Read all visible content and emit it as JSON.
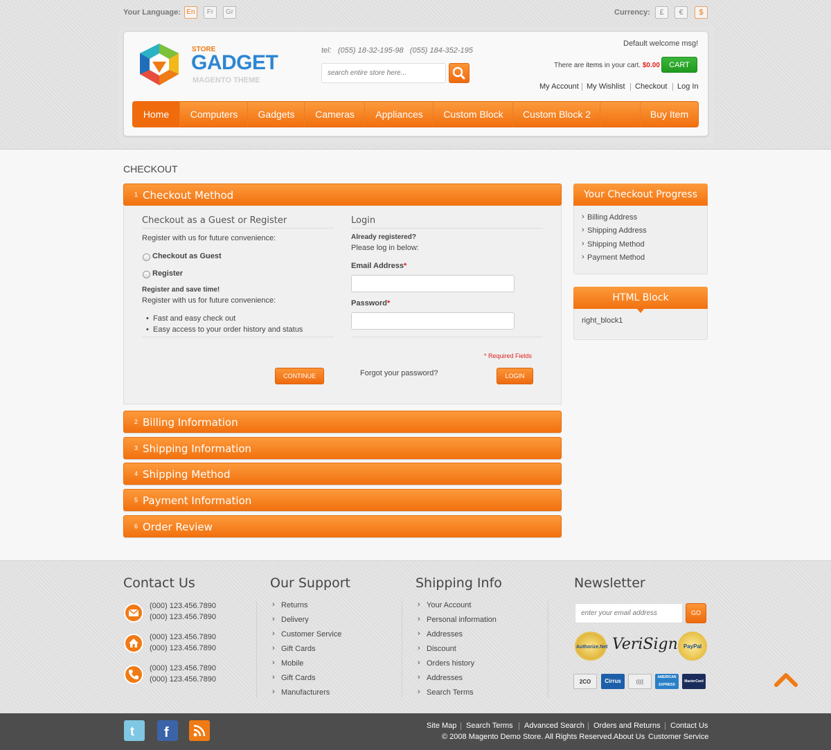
{
  "topbar": {
    "language_label": "Your Language:",
    "languages": [
      "En",
      "Fr",
      "Gr"
    ],
    "currency_label": "Currency:",
    "currencies": [
      "£",
      "€",
      "$"
    ]
  },
  "logo": {
    "store": "STORE",
    "name": "GADGET",
    "subtitle": "MAGENTO THEME"
  },
  "header": {
    "tel": "tel:   (055) 18-32-195-98   (055) 184-352-195",
    "search_placeholder": "search entire store here...",
    "welcome": "Default welcome msg!",
    "cart_text_prefix": "There are ",
    "cart_items": "items",
    "cart_text_suffix": " in your cart.",
    "cart_amount": "$0.00",
    "cart_button": "CART",
    "links": [
      "My Account",
      "My Wishlist",
      "Checkout",
      "Log In"
    ]
  },
  "nav": {
    "items": [
      "Home",
      "Computers",
      "Gadgets",
      "Cameras",
      "Appliances",
      "Custom Block",
      "Custom Block 2"
    ],
    "buy_item": "Buy Item"
  },
  "page": {
    "title": "CHECKOUT"
  },
  "checkout": {
    "steps": [
      {
        "num": "1",
        "title": "Checkout Method"
      },
      {
        "num": "2",
        "title": "Billing Information"
      },
      {
        "num": "3",
        "title": "Shipping Information"
      },
      {
        "num": "4",
        "title": "Shipping Method"
      },
      {
        "num": "5",
        "title": "Payment Information"
      },
      {
        "num": "6",
        "title": "Order Review"
      }
    ],
    "guest": {
      "heading": "Checkout as a Guest or Register",
      "intro": "Register with us for future convenience:",
      "option_guest": "Checkout as Guest",
      "option_register": "Register",
      "save_time": "Register and save time!",
      "intro2": "Register with us for future convenience:",
      "bullets": [
        "Fast and easy check out",
        "Easy access to your order history and status"
      ],
      "continue": "CONTINUE"
    },
    "login": {
      "heading": "Login",
      "already": "Already registered?",
      "please": "Please log in below:",
      "email_label": "Email Address",
      "password_label": "Password",
      "required_mark": "*",
      "required_note": "* Required Fields",
      "forgot": "Forgot your password?",
      "login_btn": "LOGIN"
    }
  },
  "sidebar": {
    "progress_title": "Your Checkout Progress",
    "progress_items": [
      "Billing Address",
      "Shipping Address",
      "Shipping Method",
      "Payment Method"
    ],
    "html_block_title": "HTML Block",
    "html_block_text": "right_block1"
  },
  "footer": {
    "contact": {
      "title": "Contact Us",
      "phones": [
        "(000) 123.456.7890",
        "(000) 123.456.7890",
        "(000) 123.456.7890",
        "(000) 123.456.7890",
        "(000) 123.456.7890",
        "(000) 123.456.7890"
      ]
    },
    "support": {
      "title": "Our Support",
      "links": [
        "Returns",
        "Delivery",
        "Customer Service",
        "Gift Cards",
        "Mobile",
        "Gift Cards",
        "Manufacturers"
      ]
    },
    "shipping": {
      "title": "Shipping Info",
      "links": [
        "Your Account",
        "Personal information",
        "Addresses",
        "Discount",
        "Orders history",
        "Addresses",
        "Search Terms"
      ]
    },
    "newsletter": {
      "title": "Newsletter",
      "placeholder": "enter your email address",
      "go": "GO",
      "badges": [
        "Authorize.Net",
        "VeriSign",
        "PayPal"
      ],
      "cards": [
        "2CO",
        "Cirrus",
        "((((",
        "AMERICAN EXPRESS",
        "MasterCard"
      ]
    }
  },
  "bottom": {
    "links": [
      "Site Map",
      "Search Terms",
      "Advanced Search",
      "Orders and Returns",
      "Contact Us"
    ],
    "copyright": "© 2008 Magento Demo Store. All Rights Reserved.",
    "about": "About Us",
    "customer_service": "Customer Service"
  },
  "colors": {
    "accent": "#f07a14",
    "cart_green": "#28a428",
    "logo_blue": "#2d86d2",
    "price_red": "#e02020"
  }
}
